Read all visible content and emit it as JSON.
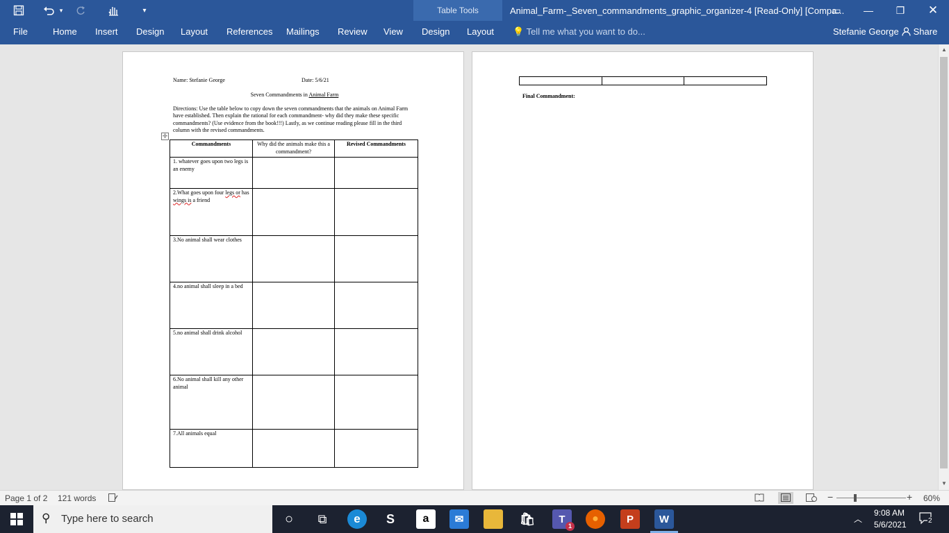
{
  "app": {
    "qat": {
      "save_icon": "save-icon",
      "undo_icon": "undo-icon",
      "redo_icon": "redo-icon",
      "touch_icon": "touch-mode-icon",
      "customize_icon": "customize-qat-icon"
    },
    "contextual_group": "Table Tools",
    "doc_title": "Animal_Farm-_Seven_commandments_graphic_organizer-4 [Read-Only] [Compa...",
    "window_controls": {
      "ribbon_display": "▭",
      "minimize": "—",
      "restore": "❐",
      "close": "✕"
    },
    "tabs": [
      "File",
      "Home",
      "Insert",
      "Design",
      "Layout",
      "References",
      "Mailings",
      "Review",
      "View",
      "Design",
      "Layout"
    ],
    "tell_me": "Tell me what you want to do...",
    "user": "Stefanie George",
    "share": "Share"
  },
  "document": {
    "page1": {
      "name_line": "Name: Stefanie George",
      "date_line": "Date: 5/6/21",
      "heading_prefix": "Seven Commandments in ",
      "heading_book": "Animal Farm",
      "directions": "Directions:  Use the table below to copy down the seven commandments that the animals on Animal Farm have established.  Then explain the rational for each commandment- why did they make these specific commandments? (Use evidence from the book!!!) Lastly, as we continue reading please fill in the third column with the revised commandments.",
      "table": {
        "headers": [
          "Commandments",
          "Why did the animals make this a commandment?",
          "Revised Commandments"
        ],
        "rows": [
          "1. whatever goes upon two legs is an enemy",
          "2.What goes upon four legs or has wings is a friend",
          "3.No animal shall wear clothes",
          "4.no animal shall sleep in a bed",
          "5.no animal shall drink alcohol",
          "6.No animal shall kill any other animal",
          "7.All animals equal"
        ],
        "row2_parts": {
          "pre": "2.What goes upon four ",
          "sq1": "legs or",
          "mid": " has ",
          "sq2": "wings is",
          "post": " a friend"
        }
      }
    },
    "page2": {
      "final_commandment": "Final Commandment:"
    }
  },
  "status": {
    "page": "Page 1 of 2",
    "words": "121 words",
    "zoom_minus": "−",
    "zoom_plus": "+",
    "zoom": "60%"
  },
  "taskbar": {
    "search_placeholder": "Type here to search",
    "apps": [
      {
        "name": "cortana",
        "glyph": "○"
      },
      {
        "name": "task-view",
        "glyph": "⧉"
      },
      {
        "name": "edge",
        "glyph": "e"
      },
      {
        "name": "app-s",
        "glyph": "S"
      },
      {
        "name": "amazon",
        "glyph": "a"
      },
      {
        "name": "mail",
        "glyph": "✉"
      },
      {
        "name": "file-explorer",
        "glyph": "▬"
      },
      {
        "name": "store",
        "glyph": "🛍"
      },
      {
        "name": "teams",
        "glyph": "T"
      },
      {
        "name": "firefox",
        "glyph": "●"
      },
      {
        "name": "powerpoint",
        "glyph": "P"
      },
      {
        "name": "word",
        "glyph": "W"
      }
    ],
    "teams_badge": "1",
    "time": "9:08 AM",
    "date": "5/6/2021",
    "notification_count": "2"
  }
}
